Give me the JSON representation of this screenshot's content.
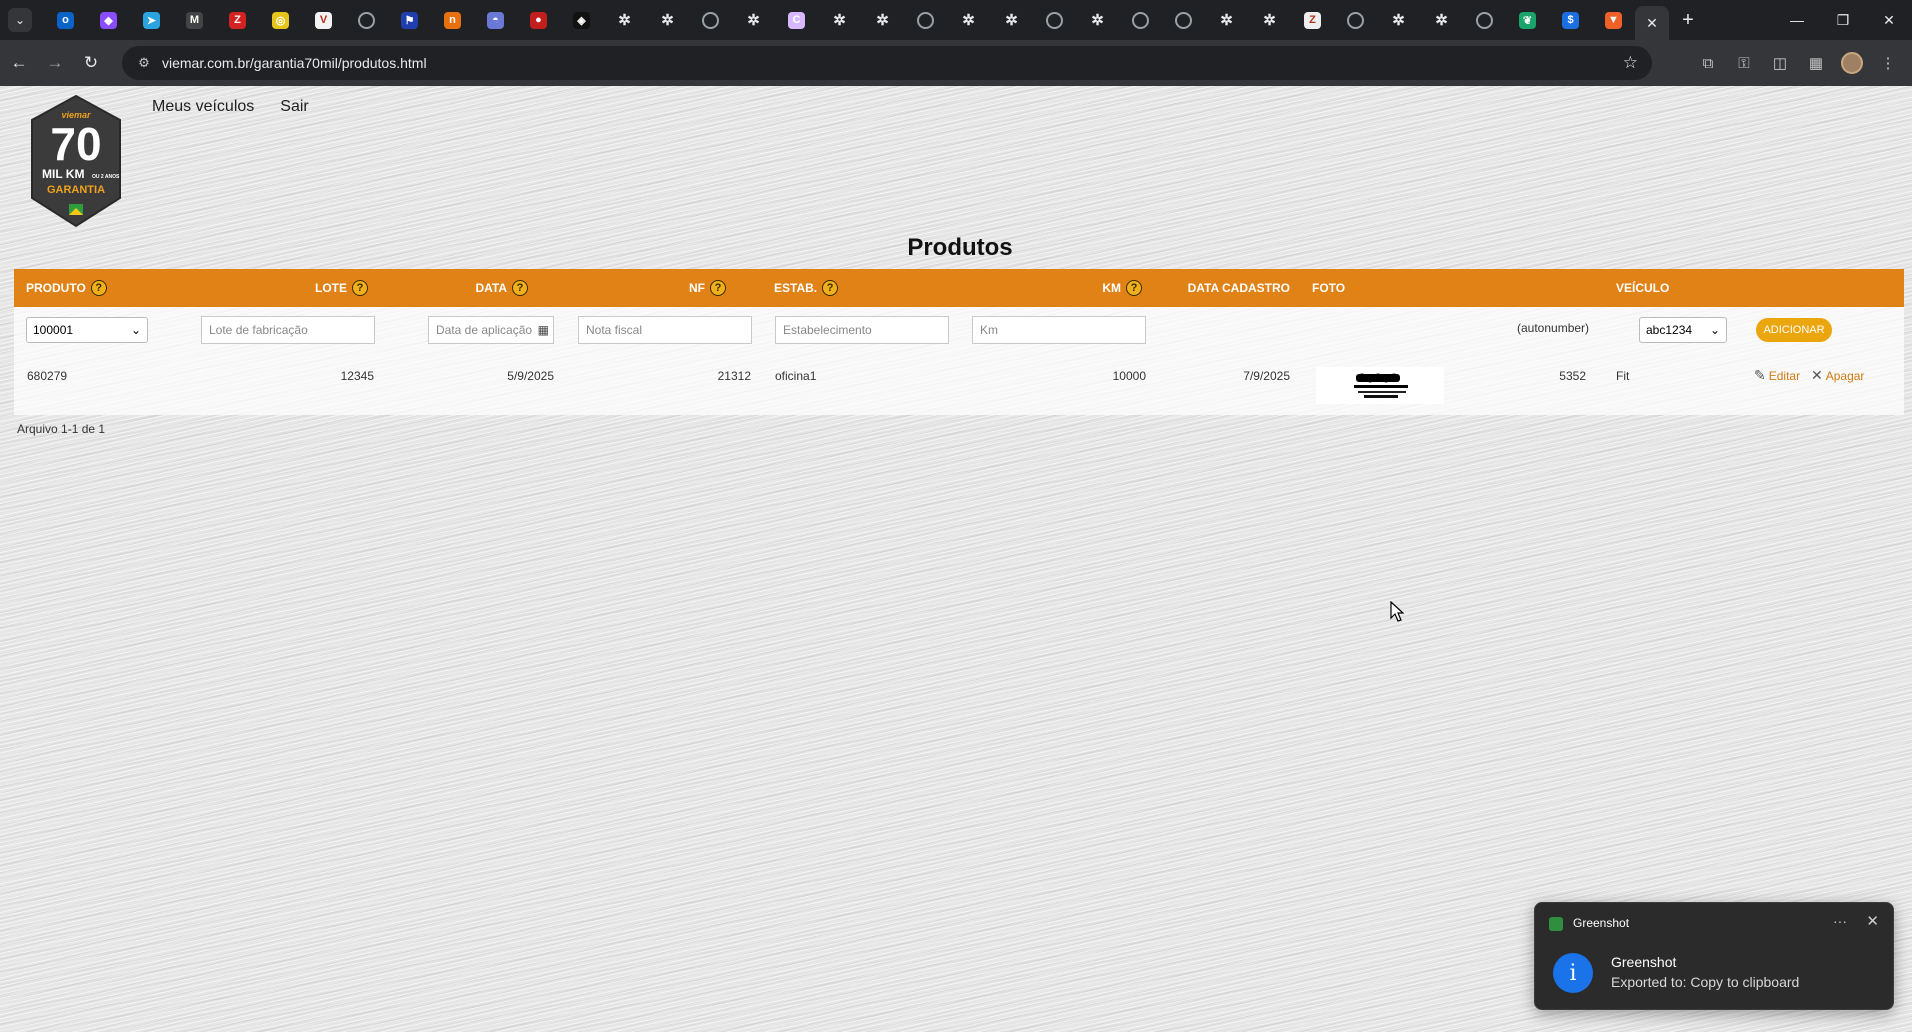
{
  "browser": {
    "tab_search_label": "def",
    "pinned_tabs": [
      {
        "name": "outlook",
        "color": "#0a64c8",
        "glyph": "o"
      },
      {
        "name": "figma",
        "color": "#8a4dff",
        "glyph": "◆"
      },
      {
        "name": "telegram",
        "color": "#2aa3e0",
        "glyph": "➤"
      },
      {
        "name": "gmail",
        "color": "#444",
        "glyph": "M"
      },
      {
        "name": "zotero",
        "color": "#d32222",
        "glyph": "Z"
      },
      {
        "name": "app-yellow",
        "color": "#e6c418",
        "glyph": "◎"
      },
      {
        "name": "brave-search",
        "color": "#f3f3f3",
        "glyph": "V"
      },
      {
        "name": "globe",
        "color": "",
        "glyph": ""
      },
      {
        "name": "bookmark-blue",
        "color": "#1f3fae",
        "glyph": "⚑"
      },
      {
        "name": "notion-n",
        "color": "#e8700e",
        "glyph": "n"
      },
      {
        "name": "incognito",
        "color": "#6b79d6",
        "glyph": "◓"
      },
      {
        "name": "red-dots",
        "color": "#c31e1e",
        "glyph": "●"
      },
      {
        "name": "codepen",
        "color": "#111",
        "glyph": "◈"
      },
      {
        "name": "chatgpt",
        "color": "",
        "glyph": "✲"
      },
      {
        "name": "chatgpt",
        "color": "",
        "glyph": "✲"
      },
      {
        "name": "globe",
        "color": "",
        "glyph": ""
      },
      {
        "name": "chatgpt",
        "color": "",
        "glyph": "✲"
      },
      {
        "name": "claude-c",
        "color": "#d7b8ff",
        "glyph": "C"
      },
      {
        "name": "chatgpt",
        "color": "",
        "glyph": "✲"
      },
      {
        "name": "chatgpt",
        "color": "",
        "glyph": "✲"
      },
      {
        "name": "globe",
        "color": "",
        "glyph": ""
      },
      {
        "name": "chatgpt",
        "color": "",
        "glyph": "✲"
      },
      {
        "name": "chatgpt",
        "color": "",
        "glyph": "✲"
      },
      {
        "name": "globe",
        "color": "",
        "glyph": ""
      },
      {
        "name": "chatgpt",
        "color": "",
        "glyph": "✲"
      },
      {
        "name": "globe",
        "color": "",
        "glyph": ""
      },
      {
        "name": "globe",
        "color": "",
        "glyph": ""
      },
      {
        "name": "chatgpt",
        "color": "",
        "glyph": "✲"
      },
      {
        "name": "chatgpt",
        "color": "",
        "glyph": "✲"
      },
      {
        "name": "zotero-z",
        "color": "#eee",
        "glyph": "Z"
      },
      {
        "name": "globe",
        "color": "",
        "glyph": ""
      },
      {
        "name": "chatgpt",
        "color": "",
        "glyph": "✲"
      },
      {
        "name": "chatgpt",
        "color": "",
        "glyph": "✲"
      },
      {
        "name": "globe",
        "color": "",
        "glyph": ""
      },
      {
        "name": "green-leaf",
        "color": "#1aa36a",
        "glyph": "❦"
      },
      {
        "name": "blue-s",
        "color": "#1b6fe0",
        "glyph": "$"
      },
      {
        "name": "brave",
        "color": "#f0612a",
        "glyph": "▼"
      }
    ],
    "url": "viemar.com.br/garantia70mil/produtos.html"
  },
  "page": {
    "logo": {
      "brand": "viemar",
      "big_number": "70",
      "line1": "MIL KM",
      "line1_small": "OU 2 ANOS",
      "line2": "GARANTIA"
    },
    "nav": {
      "meus_veiculos": "Meus veículos",
      "sair": "Sair"
    },
    "title": "Produtos"
  },
  "grid": {
    "headers": {
      "produto": "PRODUTO",
      "lote": "LOTE",
      "data": "DATA",
      "nf": "NF",
      "estab": "ESTAB.",
      "km": "KM",
      "data_cadastro": "DATA CADASTRO",
      "foto": "FOTO",
      "veiculo": "VEÍCULO"
    },
    "help_glyph": "?",
    "new_row": {
      "produto_value": "100001",
      "lote_placeholder": "Lote de fabricação",
      "data_placeholder": "Data de aplicação",
      "nf_placeholder": "Nota fiscal",
      "estab_placeholder": "Estabelecimento",
      "km_placeholder": "Km",
      "autonumber": "(autonumber)",
      "veiculo_value": "abc1234",
      "add_label": "ADICIONAR"
    },
    "rows": [
      {
        "produto": "680279",
        "lote": "12345",
        "data": "5/9/2025",
        "nf": "21312",
        "estab": "oficina1",
        "km": "10000",
        "data_cadastro": "7/9/2025",
        "id": "5352",
        "veiculo": "Fit",
        "edit_label": "Editar",
        "delete_label": "Apagar"
      }
    ],
    "footer": "Arquivo 1-1 de 1"
  },
  "toast": {
    "app_name": "Greenshot",
    "title": "Greenshot",
    "message": "Exported to: Copy to clipboard",
    "more_glyph": "···",
    "close_glyph": "✕",
    "info_glyph": "i"
  },
  "colors": {
    "header_orange": "#e08216",
    "button_yellow": "#eba50d",
    "link_orange": "#d07a12"
  }
}
